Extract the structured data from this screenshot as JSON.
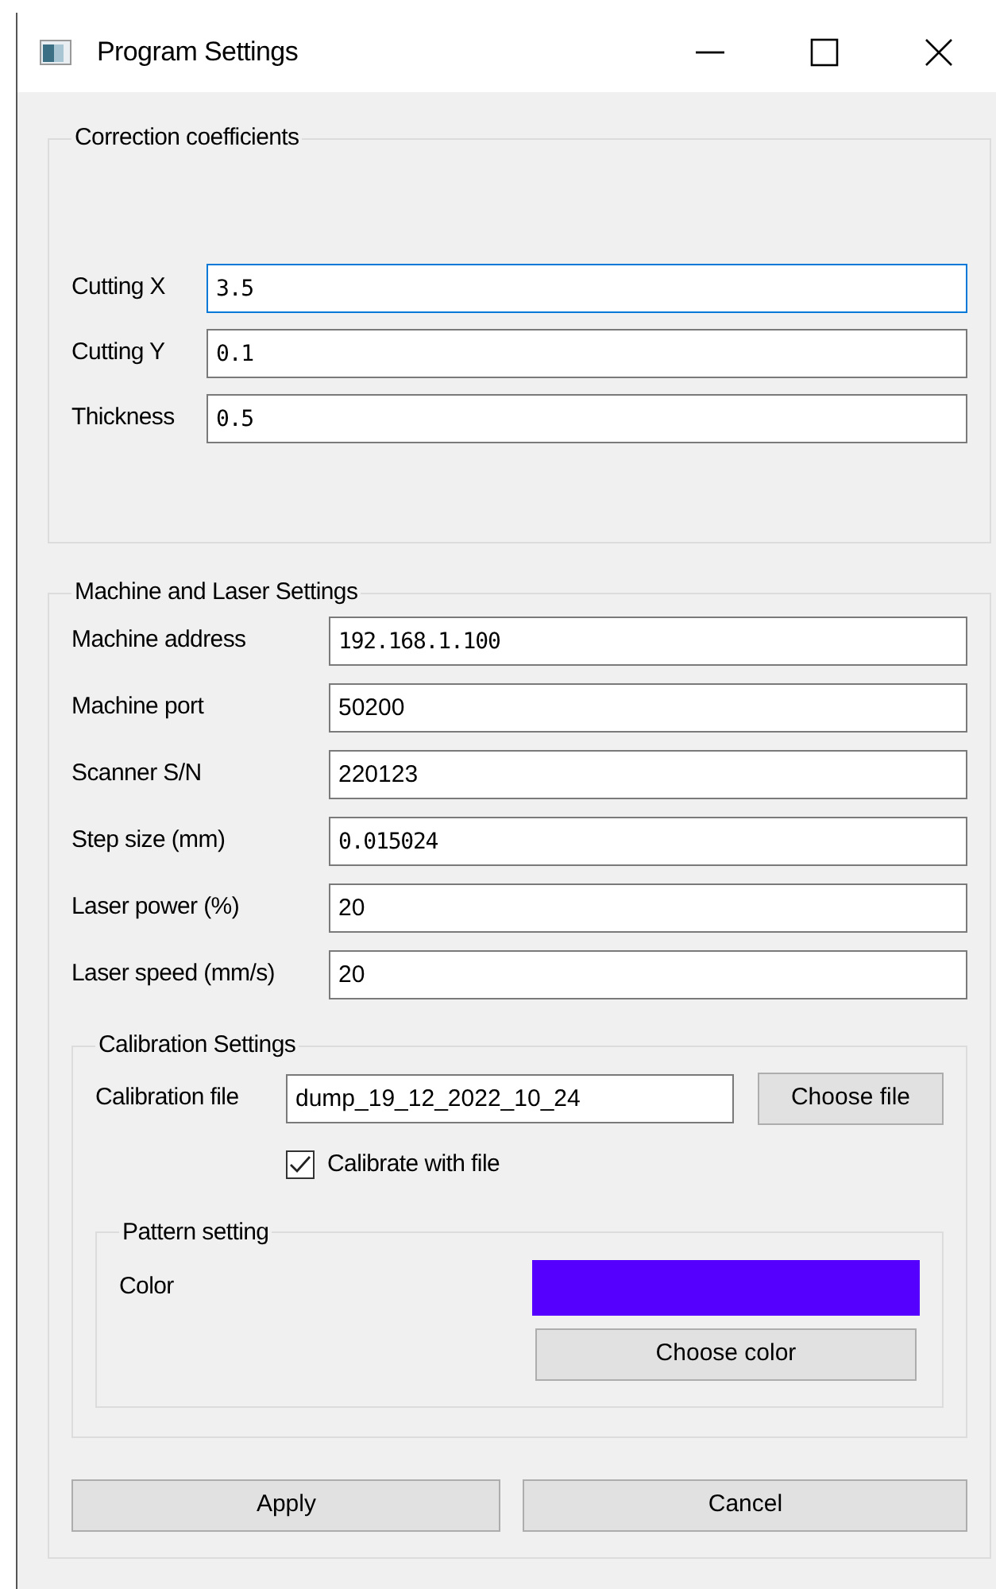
{
  "window": {
    "title": "Program Settings"
  },
  "correction": {
    "title": "Correction coefficients",
    "fields": [
      {
        "label": "Cutting X",
        "value": "3.5",
        "focused": true
      },
      {
        "label": "Cutting Y",
        "value": "0.1",
        "focused": false
      },
      {
        "label": "Thickness",
        "value": "0.5",
        "focused": false
      }
    ]
  },
  "machine": {
    "title": "Machine and Laser Settings",
    "fields": [
      {
        "label": "Machine address",
        "value": "192.168.1.100"
      },
      {
        "label": "Machine port",
        "value": "50200"
      },
      {
        "label": "Scanner S/N",
        "value": "220123"
      },
      {
        "label": "Step size (mm)",
        "value": "0.015024"
      },
      {
        "label": "Laser power (%)",
        "value": "20"
      },
      {
        "label": "Laser speed (mm/s)",
        "value": "20"
      }
    ],
    "calibration": {
      "title": "Calibration Settings",
      "file_label": "Calibration file",
      "file_value": "dump_19_12_2022_10_24",
      "choose_file": "Choose file",
      "checkbox": {
        "label": "Calibrate with file",
        "checked": true
      },
      "pattern": {
        "title": "Pattern setting",
        "color_label": "Color",
        "color": "#5500ff",
        "choose_color": "Choose color"
      }
    }
  },
  "buttons": [
    "Apply",
    "Cancel"
  ]
}
